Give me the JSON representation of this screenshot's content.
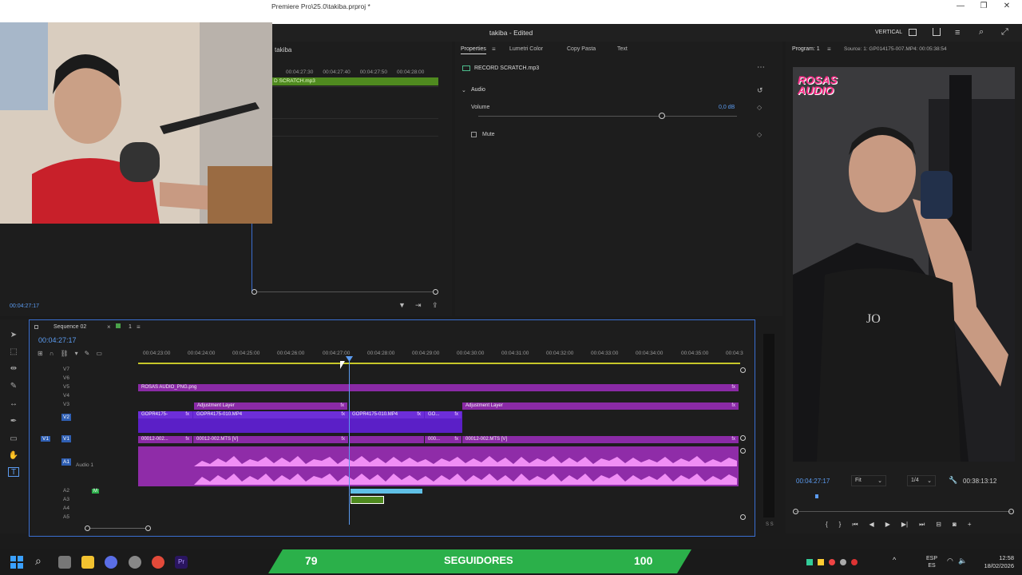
{
  "window": {
    "title": "Premiere Pro\\25.0\\takiba.prproj *",
    "min": "—",
    "restore": "❐",
    "close": "✕"
  },
  "app": {
    "project_title": "takiba - Edited",
    "workspace": "VERTICAL"
  },
  "source_monitor": {
    "tab": "takiba",
    "ruler": [
      "00:04:27:30",
      "00:04:27:40",
      "00:04:27:50",
      "00:04:28:00"
    ],
    "clip": "D SCRATCH.mp3",
    "timecode": "00:04:27:17"
  },
  "properties": {
    "tabs": [
      "Properties",
      "Lumetri Color",
      "Copy Pasta",
      "Text"
    ],
    "clip_name": "RECORD SCRATCH.mp3",
    "section": "Audio",
    "volume_label": "Volume",
    "volume_value": "0,0 dB",
    "volume_level": 0.71,
    "mute_label": "Mute"
  },
  "program_monitor": {
    "tab": "Program: 1",
    "source": "Source: 1: GP014175-007.MP4: 00:05:38:54",
    "timecode": "00:04:27:17",
    "fit": "Fit",
    "resolution": "1/4",
    "duration": "00:38:13:12",
    "overlay_logo": [
      "ROSAS",
      "AUDIO"
    ]
  },
  "timeline": {
    "sequence": "Sequence 02",
    "sequence_count": "1",
    "timecode": "00:04:27:17",
    "ruler": [
      "00:04:23:00",
      "00:04:24:00",
      "00:04:25:00",
      "00:04:26:00",
      "00:04:27:00",
      "00:04:28:00",
      "00:04:29:00",
      "00:04:30:00",
      "00:04:31:00",
      "00:04:32:00",
      "00:04:33:00",
      "00:04:34:00",
      "00:04:35:00",
      "00:04:3"
    ],
    "tracks": [
      "V7",
      "V6",
      "V5",
      "V4",
      "V3",
      "V2",
      "V1",
      "A1",
      "A2",
      "A3",
      "A4",
      "A5"
    ],
    "audio1_name": "Audio 1",
    "clips": {
      "v5": "ROSAS AUDIO_PNG.png",
      "v3a": "Adjustment Layer",
      "v3b": "Adjustment Layer",
      "v2a": "GOPR4175-",
      "v2b": "GOPR4175-010.MP4",
      "v2c": "GOPR4175-010.MP4",
      "v2d": "GO...",
      "v1a": "00012-002...",
      "v1b": "00012-002.MTS [V]",
      "v1c": "000...",
      "v1d": "00012-002.MTS [V]"
    },
    "fx": "fx",
    "level_meter": "S S"
  },
  "overlay": {
    "followers": "79",
    "label": "SEGUIDORES",
    "goal": "100"
  },
  "taskbar": {
    "lang": "ESP",
    "lang2": "ES",
    "time": "12:58",
    "date": "18/02/2026"
  }
}
